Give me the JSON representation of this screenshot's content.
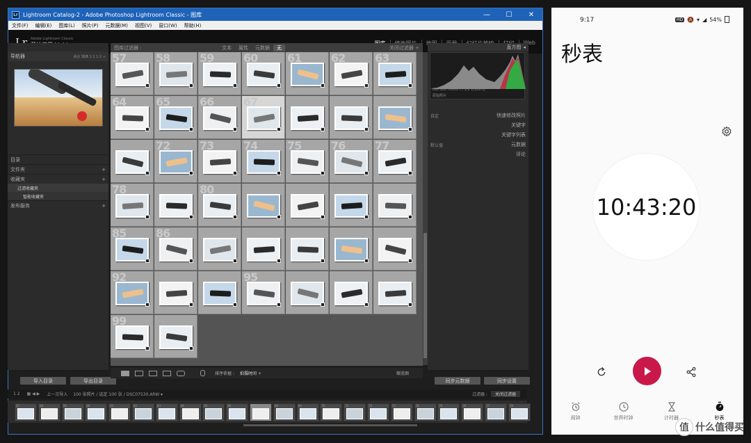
{
  "window": {
    "title": "Lightroom Catalog-2 - Adobe Photoshop Lightroom Classic - 图库",
    "app_icon": "Lr",
    "controls": {
      "min": "—",
      "max": "☐",
      "close": "✕"
    }
  },
  "menu": [
    "文件(F)",
    "编辑(E)",
    "图库(L)",
    "照片(P)",
    "元数据(M)",
    "视图(V)",
    "窗口(W)",
    "帮助(H)"
  ],
  "identity": {
    "logo": "Lr",
    "small": "Adobe Lightroom Classic",
    "main": "开始使用 Lightroom ▸"
  },
  "modules": [
    "图库",
    "修改照片",
    "地图",
    "画册",
    "幻灯片放映",
    "打印",
    "Web"
  ],
  "active_module": "图库",
  "left_panel": {
    "navigator": "导航器",
    "nav_opts": "适合  填满  1:1  1:2 ÷",
    "sections": [
      "目录",
      "文件夹",
      "收藏夹"
    ],
    "collections": [
      "过滤收藏夹",
      "智能收藏夹"
    ],
    "publish": "发布服务",
    "import_btn": "导入目录",
    "export_btn": "导出目录"
  },
  "filter_bar": {
    "title": "图库过滤器 :",
    "tabs": [
      "文本",
      "属性",
      "元数据",
      "无"
    ],
    "active": "无",
    "preset": "关闭过滤器 ÷"
  },
  "grid": {
    "cells": [
      {
        "n": "57"
      },
      {
        "n": "58"
      },
      {
        "n": "59"
      },
      {
        "n": "60"
      },
      {
        "n": "61"
      },
      {
        "n": "62"
      },
      {
        "n": "63"
      },
      {
        "n": "64"
      },
      {
        "n": "65"
      },
      {
        "n": "66"
      },
      {
        "n": "67"
      },
      {
        "n": ""
      },
      {
        "n": ""
      },
      {
        "n": ""
      },
      {
        "n": ""
      },
      {
        "n": "72"
      },
      {
        "n": "73"
      },
      {
        "n": "74"
      },
      {
        "n": "75"
      },
      {
        "n": "76"
      },
      {
        "n": "77"
      },
      {
        "n": "78"
      },
      {
        "n": ""
      },
      {
        "n": "80"
      },
      {
        "n": ""
      },
      {
        "n": ""
      },
      {
        "n": ""
      },
      {
        "n": ""
      },
      {
        "n": "85"
      },
      {
        "n": "86"
      },
      {
        "n": ""
      },
      {
        "n": ""
      },
      {
        "n": ""
      },
      {
        "n": ""
      },
      {
        "n": ""
      },
      {
        "n": "92"
      },
      {
        "n": ""
      },
      {
        "n": ""
      },
      {
        "n": "95"
      },
      {
        "n": ""
      },
      {
        "n": ""
      },
      {
        "n": ""
      },
      {
        "n": "99"
      },
      {
        "n": ""
      }
    ],
    "selected_index": 10
  },
  "right_panel": {
    "histogram": "直方图",
    "histo_info": "ISO 500    70mm    f / 1.2    1/100 秒",
    "original": "原始照片",
    "preset_label": "自定",
    "sections": [
      "快速修改照片",
      "关键字",
      "关键字列表",
      "元数据",
      "评论"
    ],
    "default_label": "默认值",
    "sync_meta": "同步元数据",
    "sync_settings": "同步设置"
  },
  "toolbar": {
    "sort_label": "排序依据 :",
    "sort_value": "拍摄时间 ÷",
    "thumbs_label": "缩览图"
  },
  "filmstrip_bar": {
    "pages": "1  2",
    "source": "上一次导入",
    "count": "100 张照片 / 选定 100 张 / DSC07530.ARW ▾",
    "filter_label": "过滤器 :",
    "filter_value": "关闭过滤器"
  },
  "filmstrip": {
    "numbers": [
      "57",
      "58",
      "59",
      "60",
      "61",
      "62",
      "63",
      "64",
      "65",
      "66",
      "67",
      "68",
      "69",
      "70",
      "71",
      "72",
      "73",
      "74",
      "75",
      "76",
      "77",
      "78"
    ],
    "selected_index": 10
  },
  "phone": {
    "time": "9:17",
    "battery": "54%",
    "hd": "HD",
    "title": "秒表",
    "timer": "10:43:20",
    "nav": [
      "闹钟",
      "世界时钟",
      "计时器",
      "秒表"
    ],
    "active_nav": "秒表"
  },
  "watermark": {
    "logo": "值",
    "text": "什么值得买"
  }
}
